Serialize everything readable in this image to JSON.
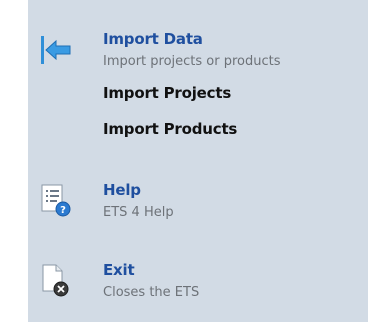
{
  "menu": {
    "import": {
      "title": "Import Data",
      "description": "Import projects or products",
      "icon": "import-arrow-icon",
      "sub_items": [
        {
          "label": "Import Projects"
        },
        {
          "label": "Import Products"
        }
      ]
    },
    "help": {
      "title": "Help",
      "description": "ETS 4 Help",
      "icon": "help-document-icon"
    },
    "exit": {
      "title": "Exit",
      "description": "Closes the ETS",
      "icon": "exit-document-icon"
    }
  },
  "colors": {
    "panel_background": "#d2dbe5",
    "title_blue": "#1f4f9f",
    "description_gray": "#6d7278",
    "sub_item_black": "#111111"
  }
}
